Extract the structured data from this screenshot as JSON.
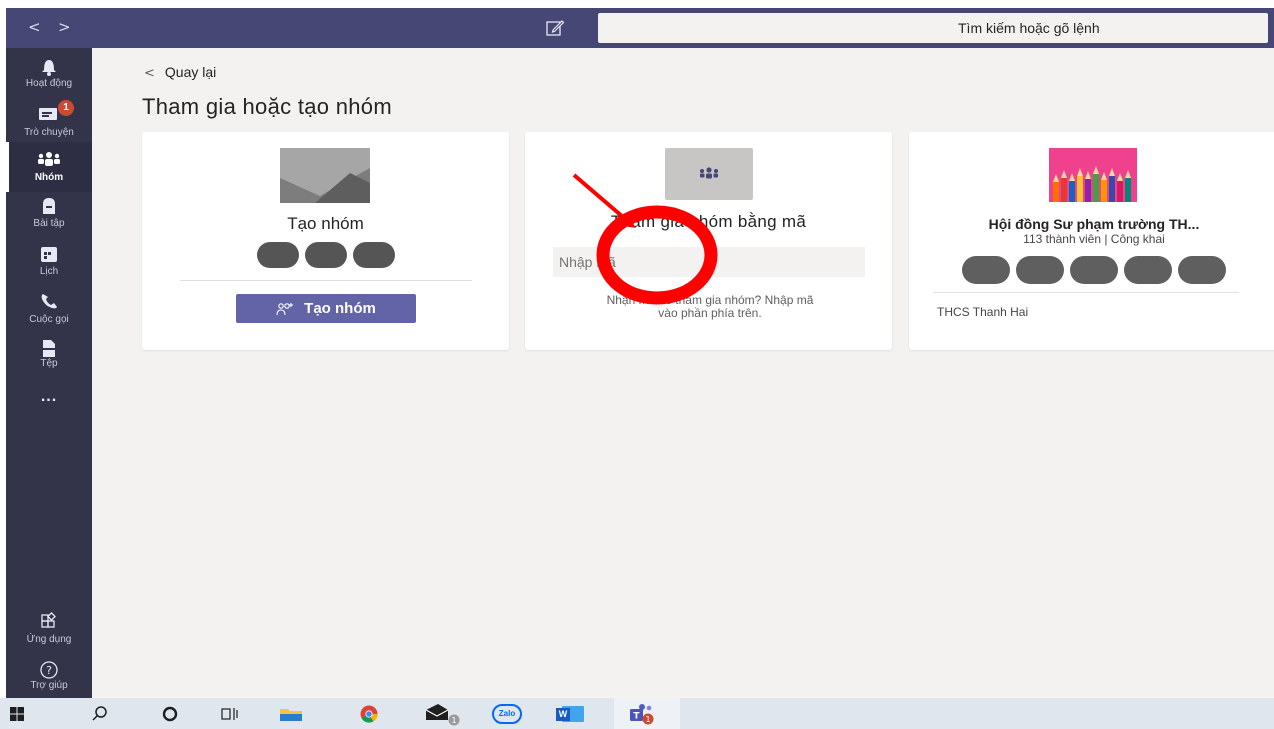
{
  "topbar": {
    "back_arrow": "<",
    "forward_arrow": ">",
    "compose_icon": "compose-icon",
    "search_placeholder": "Tìm kiếm hoặc gõ lệnh"
  },
  "rail": {
    "items": [
      {
        "label": "Hoạt động",
        "icon": "bell-icon"
      },
      {
        "label": "Trò chuyện",
        "icon": "chat-icon",
        "badge": "1"
      },
      {
        "label": "Nhóm",
        "icon": "teams-icon",
        "active": true
      },
      {
        "label": "Bài tập",
        "icon": "assignments-icon"
      },
      {
        "label": "Lịch",
        "icon": "calendar-icon"
      },
      {
        "label": "Cuộc gọi",
        "icon": "phone-icon"
      },
      {
        "label": "Tệp",
        "icon": "file-icon"
      },
      {
        "label": "...",
        "icon": "more-icon"
      }
    ],
    "bottom": [
      {
        "label": "Ứng dụng",
        "icon": "apps-icon"
      },
      {
        "label": "Trợ giúp",
        "icon": "help-icon"
      }
    ]
  },
  "main": {
    "back_label": "Quay lại",
    "title": "Tham gia hoặc tạo nhóm",
    "cards": {
      "create": {
        "title": "Tạo nhóm",
        "button_label": "Tạo nhóm"
      },
      "join": {
        "title": "Tham gia nhóm bằng mã",
        "input_placeholder": "Nhập mã",
        "help_line1": "Nhận mã để tham gia nhóm? Nhập mã",
        "help_line2": "vào phần phía trên."
      },
      "team": {
        "title": "Hội đồng Sư phạm trường TH...",
        "subtitle": "113 thành viên | Công khai",
        "footer": "THCS Thanh Hai"
      }
    }
  },
  "annotation": {
    "color": "#ff0000"
  },
  "colors": {
    "accent": "#6264a7",
    "topbar": "#464775",
    "rail": "#33344a",
    "badge": "#cc4a31"
  },
  "taskbar": {
    "icons": [
      "windows-icon",
      "search-icon",
      "cortana-icon",
      "task-view-icon",
      "file-explorer-icon",
      "chrome-icon",
      "mail-icon",
      "zalo-icon",
      "word-icon",
      "teams-app-icon"
    ],
    "zalo_label": "Zalo",
    "word_label": "W",
    "mail_badge": "1",
    "teams_badge": "1"
  }
}
